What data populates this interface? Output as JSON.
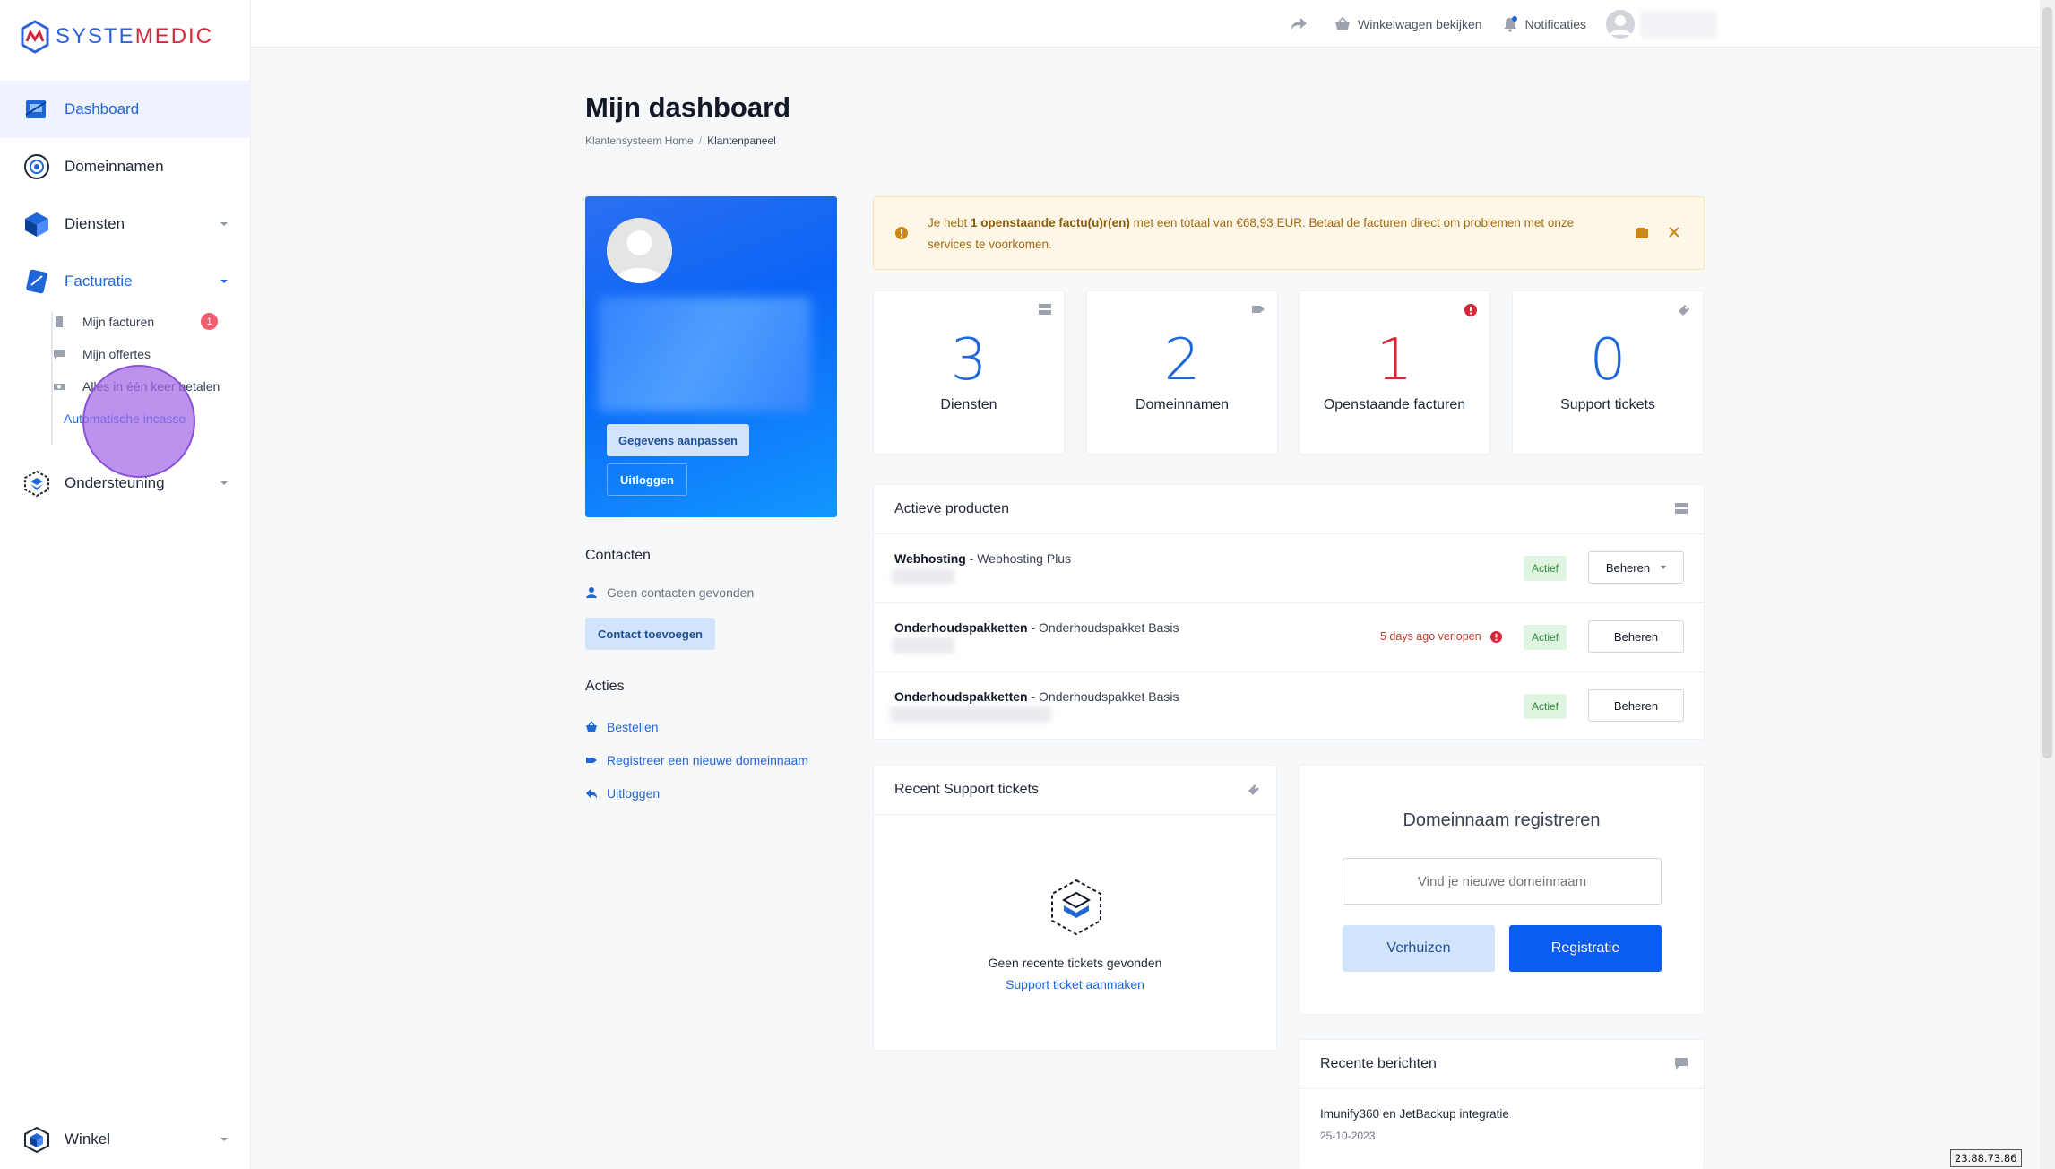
{
  "brand": {
    "logo_part1": "SYSTE",
    "logo_part2": "MEDIC"
  },
  "sidebar": {
    "items": [
      {
        "label": "Dashboard"
      },
      {
        "label": "Domeinnamen"
      },
      {
        "label": "Diensten"
      },
      {
        "label": "Facturatie"
      },
      {
        "label": "Ondersteuning"
      },
      {
        "label": "Winkel"
      }
    ],
    "sub_items": [
      {
        "label": "Mijn facturen",
        "badge": "1"
      },
      {
        "label": "Mijn offertes"
      },
      {
        "label": "Alles in één keer betalen"
      },
      {
        "label": "Automatische incasso"
      }
    ]
  },
  "topbar": {
    "cart_label": "Winkelwagen bekijken",
    "notifications_label": "Notificaties"
  },
  "page": {
    "title": "Mijn dashboard",
    "breadcrumb": [
      "Klantensysteem Home",
      "Klantenpaneel"
    ]
  },
  "profile": {
    "edit_label": "Gegevens aanpassen",
    "logout_label": "Uitloggen"
  },
  "contacts": {
    "heading": "Contacten",
    "empty_text": "Geen contacten gevonden",
    "add_label": "Contact toevoegen"
  },
  "actions": {
    "heading": "Acties",
    "links": [
      "Bestellen",
      "Registreer een nieuwe domeinnaam",
      "Uitloggen"
    ]
  },
  "alert": {
    "prefix": "Je hebt ",
    "bold": "1 openstaande factu(u)r(en)",
    "suffix": " met een totaal van €68,93 EUR. Betaal de facturen direct om problemen met onze services te voorkomen."
  },
  "stats": [
    {
      "value": "3",
      "label": "Diensten"
    },
    {
      "value": "2",
      "label": "Domeinnamen"
    },
    {
      "value": "1",
      "label": "Openstaande facturen"
    },
    {
      "value": "0",
      "label": "Support tickets"
    }
  ],
  "products": {
    "title": "Actieve producten",
    "rows": [
      {
        "group": "Webhosting",
        "name": " - Webhosting Plus",
        "status": "Actief",
        "action": "Beheren",
        "expiry": ""
      },
      {
        "group": "Onderhoudspakketten",
        "name": " - Onderhoudspakket Basis",
        "status": "Actief",
        "action": "Beheren",
        "expiry": "5 days ago verlopen"
      },
      {
        "group": "Onderhoudspakketten",
        "name": " - Onderhoudspakket Basis",
        "status": "Actief",
        "action": "Beheren",
        "expiry": ""
      }
    ]
  },
  "tickets": {
    "title": "Recent Support tickets",
    "empty_text": "Geen recente tickets gevonden",
    "create_label": "Support ticket aanmaken"
  },
  "domain_register": {
    "title": "Domeinnaam registreren",
    "placeholder": "Vind je nieuwe domeinnaam",
    "transfer_label": "Verhuizen",
    "register_label": "Registratie"
  },
  "news": {
    "title": "Recente berichten",
    "items": [
      {
        "title": "Imunify360 en JetBackup integratie",
        "date": "25-10-2023"
      }
    ]
  },
  "ip_address": "23.88.73.86",
  "colors": {
    "primary": "#1f66d8",
    "danger": "#d6273a",
    "warning_bg": "#fef6e7",
    "success_bg": "#dff5e2"
  }
}
